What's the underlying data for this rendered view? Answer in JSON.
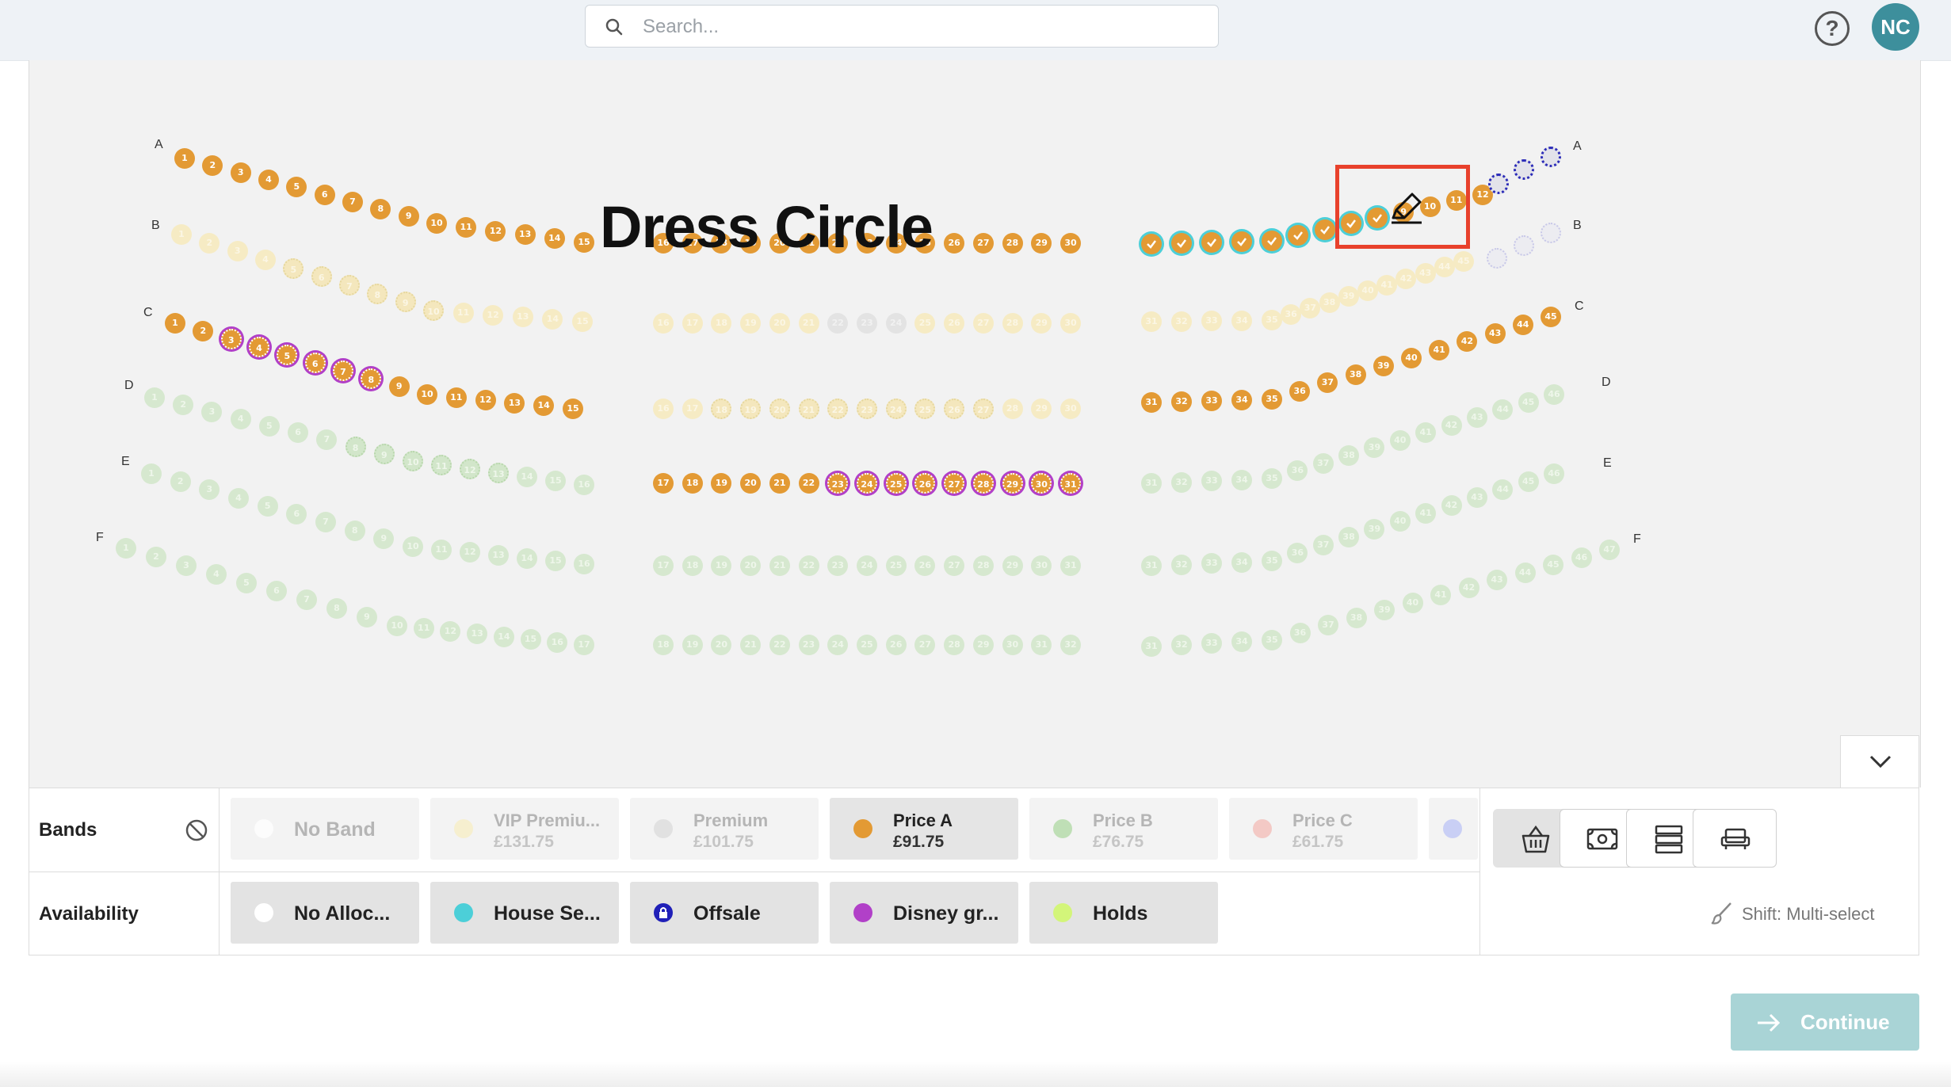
{
  "header": {
    "search_placeholder": "Search...",
    "help_label": "?",
    "avatar_initials": "NC"
  },
  "seatmap": {
    "title": "Dress Circle",
    "row_labels": [
      "A",
      "B",
      "C",
      "D",
      "E",
      "F"
    ]
  },
  "bands": {
    "label": "Bands",
    "items": [
      {
        "name": "No Band",
        "price": "",
        "color": "#ffffff",
        "state": "faded"
      },
      {
        "name": "VIP Premiu...",
        "price": "£131.75",
        "color": "#f7ecbf",
        "state": "faded"
      },
      {
        "name": "Premium",
        "price": "£101.75",
        "color": "#d9d9d9",
        "state": "faded"
      },
      {
        "name": "Price A",
        "price": "£91.75",
        "color": "#e39a34",
        "state": "selected"
      },
      {
        "name": "Price B",
        "price": "£76.75",
        "color": "#a8d59b",
        "state": "faded"
      },
      {
        "name": "Price C",
        "price": "£61.75",
        "color": "#f2b7b0",
        "state": "faded"
      }
    ]
  },
  "availability": {
    "label": "Availability",
    "items": [
      {
        "name": "No Alloc...",
        "color": "#ffffff"
      },
      {
        "name": "House Se...",
        "color": "#4ccfd8"
      },
      {
        "name": "Offsale",
        "color": "#2020b8"
      },
      {
        "name": "Disney gr...",
        "color": "#b140c8"
      },
      {
        "name": "Holds",
        "color": "#d3f57a"
      }
    ]
  },
  "tools": {
    "hint": "Shift: Multi-select"
  },
  "footer": {
    "continue_label": "Continue"
  }
}
